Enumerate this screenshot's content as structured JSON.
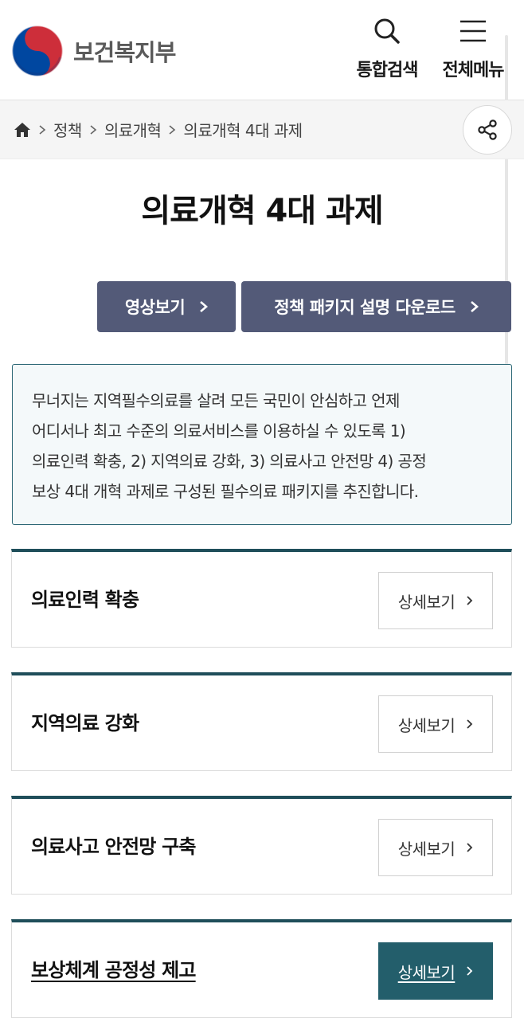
{
  "header": {
    "logo_text": "보건복지부",
    "search_label": "통합검색",
    "menu_label": "전체메뉴"
  },
  "breadcrumb": [
    "정책",
    "의료개혁",
    "의료개혁 4대 과제"
  ],
  "page_title": "의료개혁 4대 과제",
  "actions": {
    "video_label": "영상보기",
    "download_label": "정책 패키지 설명 다운로드"
  },
  "intro": {
    "lines": [
      "무너지는 지역필수의료를 살려 모든 국민이 안심하고 언제",
      "어디서나 최고 수준의 의료서비스를 이용하실 수 있도록 1)",
      "의료인력 확충, 2) 지역의료 강화, 3) 의료사고 안전망 4) 공정",
      "보상 4대 개혁 과제로 구성된 필수의료 패키지를 추진합니다."
    ]
  },
  "tasks": [
    {
      "title": "의료인력 확충",
      "button": "상세보기"
    },
    {
      "title": "지역의료 강화",
      "button": "상세보기"
    },
    {
      "title": "의료사고 안전망 구축",
      "button": "상세보기"
    },
    {
      "title": "보상체계 공정성 제고",
      "button": "상세보기"
    }
  ],
  "colors": {
    "action_button": "#535a78",
    "card_accent": "#1f4e5a",
    "active_button": "#235e6b",
    "intro_background": "#f4f9fa"
  },
  "icons": {
    "logo": "taegeuk-emblem-icon",
    "search": "search-icon",
    "menu": "hamburger-menu-icon",
    "home": "home-icon",
    "separator": "chevron-right-icon",
    "share": "share-icon"
  }
}
